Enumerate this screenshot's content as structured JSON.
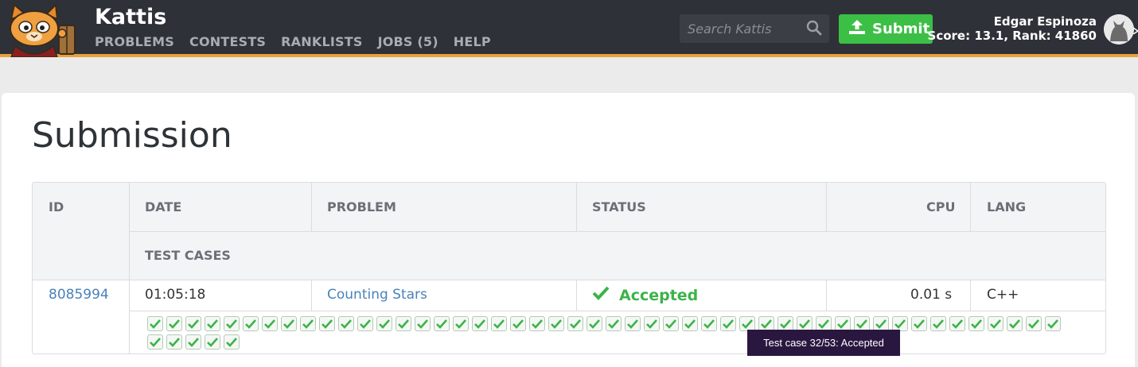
{
  "header": {
    "brand": "Kattis",
    "nav": [
      "PROBLEMS",
      "CONTESTS",
      "RANKLISTS",
      "JOBS (5)",
      "HELP"
    ],
    "search_placeholder": "Search Kattis",
    "submit_label": "Submit",
    "user_name": "Edgar Espinoza",
    "user_score": "Score: 13.1, Rank: 41860",
    "accent_color": "#e9a23b",
    "submit_color": "#3cbf45"
  },
  "page": {
    "title": "Submission"
  },
  "table": {
    "headers": {
      "id": "ID",
      "date": "DATE",
      "problem": "PROBLEM",
      "status": "STATUS",
      "cpu": "CPU",
      "lang": "LANG",
      "test_cases": "TEST CASES"
    },
    "row": {
      "id": "8085994",
      "date": "01:05:18",
      "problem": "Counting Stars",
      "status": "Accepted",
      "cpu": "0.01 s",
      "lang": "C++"
    },
    "test_case_count": 53,
    "test_case_status": "accepted"
  },
  "tooltip": {
    "text": "Test case 32/53: Accepted"
  }
}
